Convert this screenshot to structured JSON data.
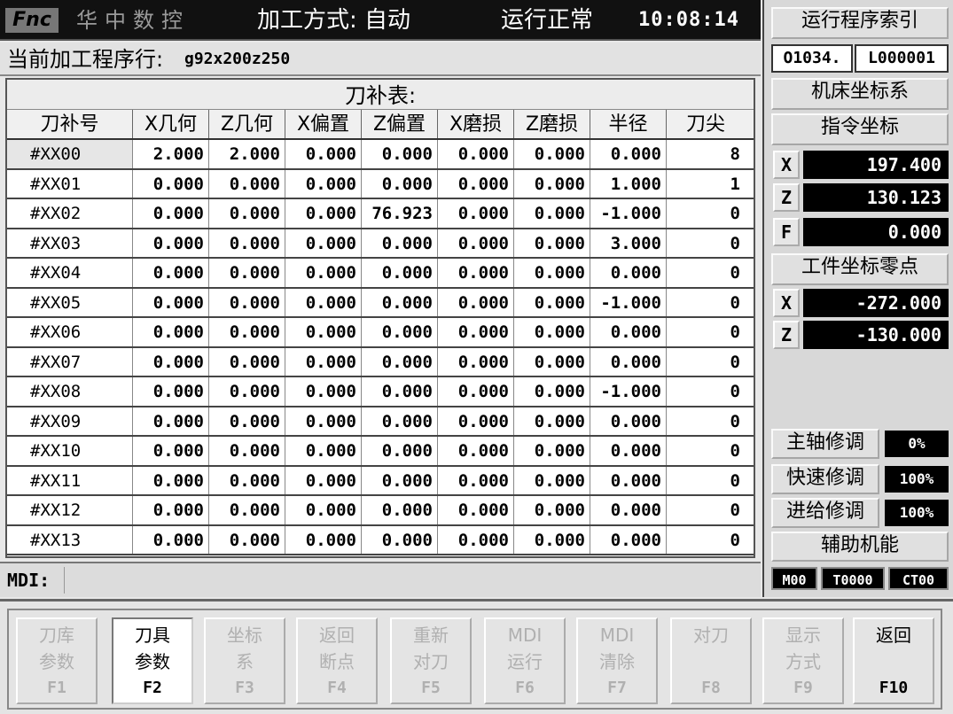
{
  "top": {
    "logo": "Fnc",
    "brand": "华中数控",
    "mode": "加工方式: 自动",
    "status": "运行正常",
    "clock": "10:08:14"
  },
  "current_line": {
    "label": "当前加工程序行:",
    "value": "g92x200z250"
  },
  "table": {
    "title": "刀补表:",
    "headers": [
      "刀补号",
      "X几何",
      "Z几何",
      "X偏置",
      "Z偏置",
      "X磨损",
      "Z磨损",
      "半径",
      "刀尖"
    ],
    "rows": [
      [
        "#XX00",
        "2.000",
        "2.000",
        "0.000",
        "0.000",
        "0.000",
        "0.000",
        "0.000",
        "8"
      ],
      [
        "#XX01",
        "0.000",
        "0.000",
        "0.000",
        "0.000",
        "0.000",
        "0.000",
        "1.000",
        "1"
      ],
      [
        "#XX02",
        "0.000",
        "0.000",
        "0.000",
        "76.923",
        "0.000",
        "0.000",
        "-1.000",
        "0"
      ],
      [
        "#XX03",
        "0.000",
        "0.000",
        "0.000",
        "0.000",
        "0.000",
        "0.000",
        "3.000",
        "0"
      ],
      [
        "#XX04",
        "0.000",
        "0.000",
        "0.000",
        "0.000",
        "0.000",
        "0.000",
        "0.000",
        "0"
      ],
      [
        "#XX05",
        "0.000",
        "0.000",
        "0.000",
        "0.000",
        "0.000",
        "0.000",
        "-1.000",
        "0"
      ],
      [
        "#XX06",
        "0.000",
        "0.000",
        "0.000",
        "0.000",
        "0.000",
        "0.000",
        "0.000",
        "0"
      ],
      [
        "#XX07",
        "0.000",
        "0.000",
        "0.000",
        "0.000",
        "0.000",
        "0.000",
        "0.000",
        "0"
      ],
      [
        "#XX08",
        "0.000",
        "0.000",
        "0.000",
        "0.000",
        "0.000",
        "0.000",
        "-1.000",
        "0"
      ],
      [
        "#XX09",
        "0.000",
        "0.000",
        "0.000",
        "0.000",
        "0.000",
        "0.000",
        "0.000",
        "0"
      ],
      [
        "#XX10",
        "0.000",
        "0.000",
        "0.000",
        "0.000",
        "0.000",
        "0.000",
        "0.000",
        "0"
      ],
      [
        "#XX11",
        "0.000",
        "0.000",
        "0.000",
        "0.000",
        "0.000",
        "0.000",
        "0.000",
        "0"
      ],
      [
        "#XX12",
        "0.000",
        "0.000",
        "0.000",
        "0.000",
        "0.000",
        "0.000",
        "0.000",
        "0"
      ],
      [
        "#XX13",
        "0.000",
        "0.000",
        "0.000",
        "0.000",
        "0.000",
        "0.000",
        "0.000",
        "0"
      ]
    ]
  },
  "mdi": {
    "label": "MDI:",
    "value": ""
  },
  "right": {
    "program_index_btn": "运行程序索引",
    "program_no": "O1034.",
    "line_no": "L000001",
    "machine_coord_btn": "机床坐标系",
    "command_coord_btn": "指令坐标",
    "command": [
      {
        "axis": "X",
        "value": "197.400"
      },
      {
        "axis": "Z",
        "value": "130.123"
      },
      {
        "axis": "F",
        "value": "0.000"
      }
    ],
    "work_zero_btn": "工件坐标零点",
    "work_zero": [
      {
        "axis": "X",
        "value": "-272.000"
      },
      {
        "axis": "Z",
        "value": "-130.000"
      }
    ],
    "overrides": [
      {
        "label": "主轴修调",
        "value": "0%"
      },
      {
        "label": "快速修调",
        "value": "100%"
      },
      {
        "label": "进给修调",
        "value": "100%"
      }
    ],
    "aux_btn": "辅助机能",
    "m_code": "M00",
    "t_code": "T0000",
    "ct_code": "CT00"
  },
  "fkeys": [
    {
      "l1": "刀库",
      "l2": "参数",
      "l3": "F1",
      "state": "disabled"
    },
    {
      "l1": "刀具",
      "l2": "参数",
      "l3": "F2",
      "state": "active"
    },
    {
      "l1": "坐标",
      "l2": "系",
      "l3": "F3",
      "state": "disabled"
    },
    {
      "l1": "返回",
      "l2": "断点",
      "l3": "F4",
      "state": "disabled"
    },
    {
      "l1": "重新",
      "l2": "对刀",
      "l3": "F5",
      "state": "disabled"
    },
    {
      "l1": "MDI",
      "l2": "运行",
      "l3": "F6",
      "state": "disabled"
    },
    {
      "l1": "MDI",
      "l2": "清除",
      "l3": "F7",
      "state": "disabled"
    },
    {
      "l1": "对刀",
      "l2": "",
      "l3": "F8",
      "state": "disabled"
    },
    {
      "l1": "显示",
      "l2": "方式",
      "l3": "F9",
      "state": "disabled"
    },
    {
      "l1": "返回",
      "l2": "",
      "l3": "F10",
      "state": "return"
    }
  ]
}
